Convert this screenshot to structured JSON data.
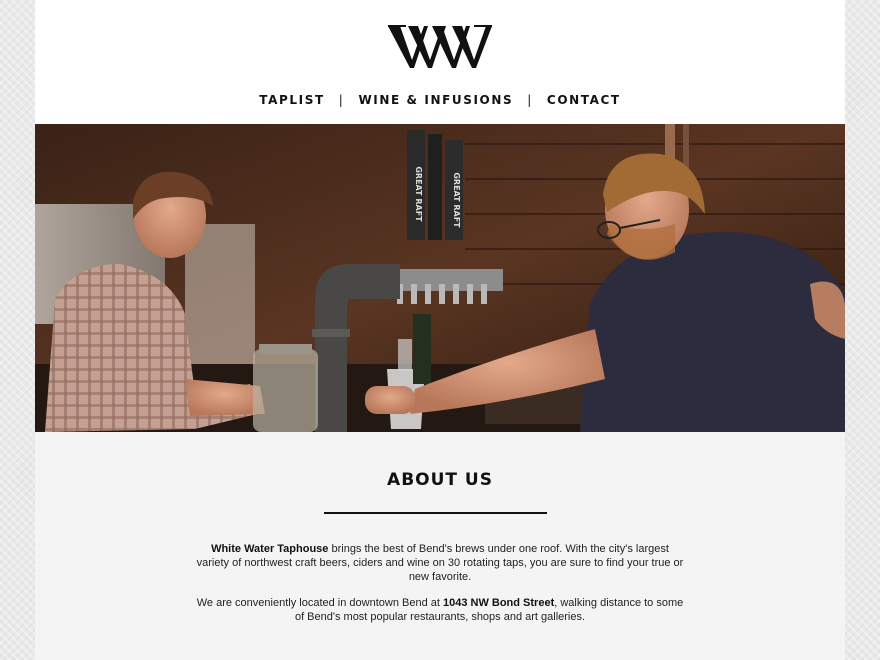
{
  "brand": {
    "logo_text": "WW"
  },
  "nav": {
    "items": [
      "TAPLIST",
      "WINE & INFUSIONS",
      "CONTACT"
    ],
    "separator": "|"
  },
  "hero": {
    "tap_label": "GREAT RAFT",
    "colors": {
      "wood": "#4a2a1a",
      "shirt_right": "#2d2b3e",
      "plaid": "#b58b7a"
    }
  },
  "about": {
    "heading": "ABOUT US",
    "p1_name": "White Water Taphouse",
    "p1_rest": " brings the best of Bend's brews under one roof. With the city's largest variety of northwest craft beers, ciders and wine on 30 rotating taps, you are sure to find your true or new favorite.",
    "p2_start": "We are conveniently located in downtown Bend at ",
    "p2_address": "1043 NW Bond Street",
    "p2_end": ", walking distance to some of Bend's most popular restaurants, shops and art galleries."
  }
}
